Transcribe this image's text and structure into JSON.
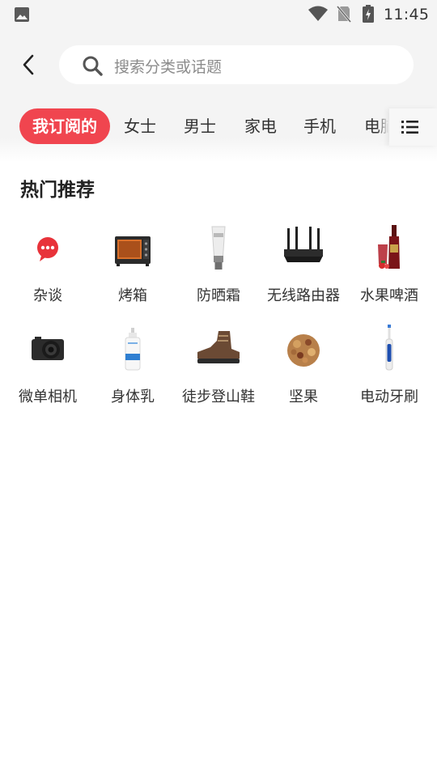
{
  "status_bar": {
    "time": "11:45",
    "icons": [
      "gallery-icon",
      "wifi-icon",
      "no-sim-icon",
      "battery-charging-icon"
    ]
  },
  "header": {
    "back_icon": "chevron-left-icon",
    "search": {
      "placeholder": "搜索分类或话题",
      "icon": "search-icon"
    }
  },
  "tabs": [
    {
      "label": "我订阅的",
      "active": true
    },
    {
      "label": "女士",
      "active": false
    },
    {
      "label": "男士",
      "active": false
    },
    {
      "label": "家电",
      "active": false
    },
    {
      "label": "手机",
      "active": false
    },
    {
      "label": "电脑",
      "active": false
    }
  ],
  "menu_icon": "list-menu-icon",
  "section": {
    "title": "热门推荐",
    "items": [
      {
        "label": "杂谈",
        "icon": "chat-bubble-icon"
      },
      {
        "label": "烤箱",
        "icon": "oven-icon"
      },
      {
        "label": "防晒霜",
        "icon": "sunscreen-icon"
      },
      {
        "label": "无线路由器",
        "icon": "wireless-router-icon"
      },
      {
        "label": "水果啤酒",
        "icon": "fruit-beer-icon"
      },
      {
        "label": "微单相机",
        "icon": "mirrorless-camera-icon"
      },
      {
        "label": "身体乳",
        "icon": "body-lotion-icon"
      },
      {
        "label": "徒步登山鞋",
        "icon": "hiking-boot-icon"
      },
      {
        "label": "坚果",
        "icon": "nuts-icon"
      },
      {
        "label": "电动牙刷",
        "icon": "electric-toothbrush-icon"
      }
    ]
  },
  "colors": {
    "accent": "#f0454f",
    "background": "#f4f4f4",
    "text": "#333333"
  }
}
